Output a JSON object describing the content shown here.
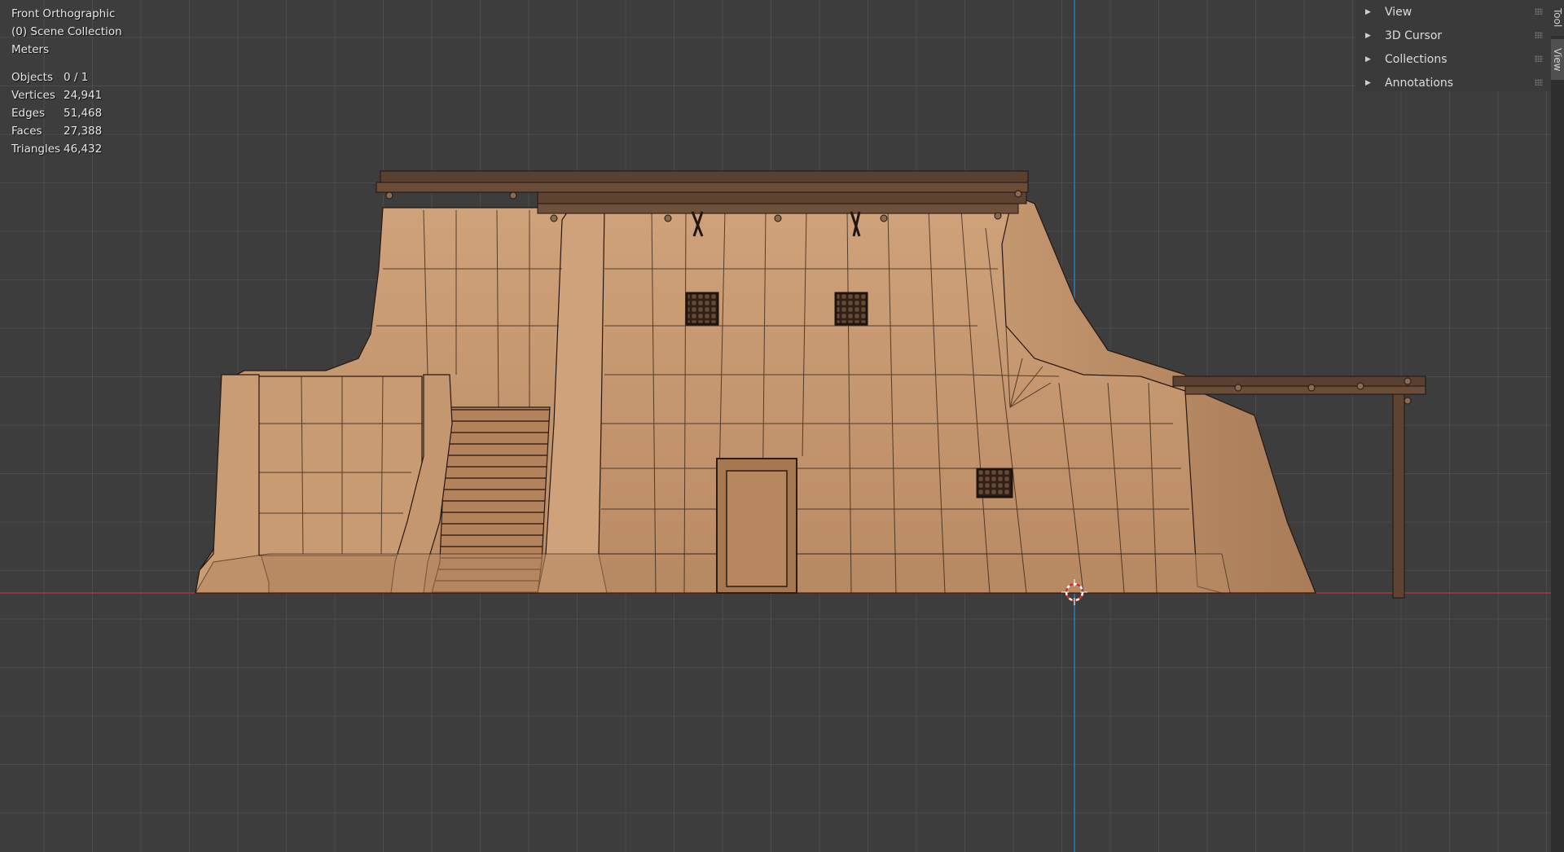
{
  "overlay": {
    "view_name": "Front Orthographic",
    "collection": "(0) Scene Collection",
    "units": "Meters"
  },
  "stats": [
    {
      "label": "Objects",
      "value": "0 / 1"
    },
    {
      "label": "Vertices",
      "value": "24,941"
    },
    {
      "label": "Edges",
      "value": "51,468"
    },
    {
      "label": "Faces",
      "value": "27,388"
    },
    {
      "label": "Triangles",
      "value": "46,432"
    }
  ],
  "sidebar_panels": [
    {
      "label": "View",
      "icon": "disclosure-triangle-right"
    },
    {
      "label": "3D Cursor",
      "icon": "disclosure-triangle-right"
    },
    {
      "label": "Collections",
      "icon": "disclosure-triangle-right"
    },
    {
      "label": "Annotations",
      "icon": "disclosure-triangle-right"
    }
  ],
  "side_tabs": [
    "Tool",
    "View"
  ],
  "colors": {
    "viewport_bg": "#3d3d3d",
    "x_axis": "#8a3a3a",
    "z_axis": "#2f6c96",
    "adobe_wall": "#c89a72",
    "wood_trim": "#5a4030",
    "wireframe": "#1e1610"
  }
}
